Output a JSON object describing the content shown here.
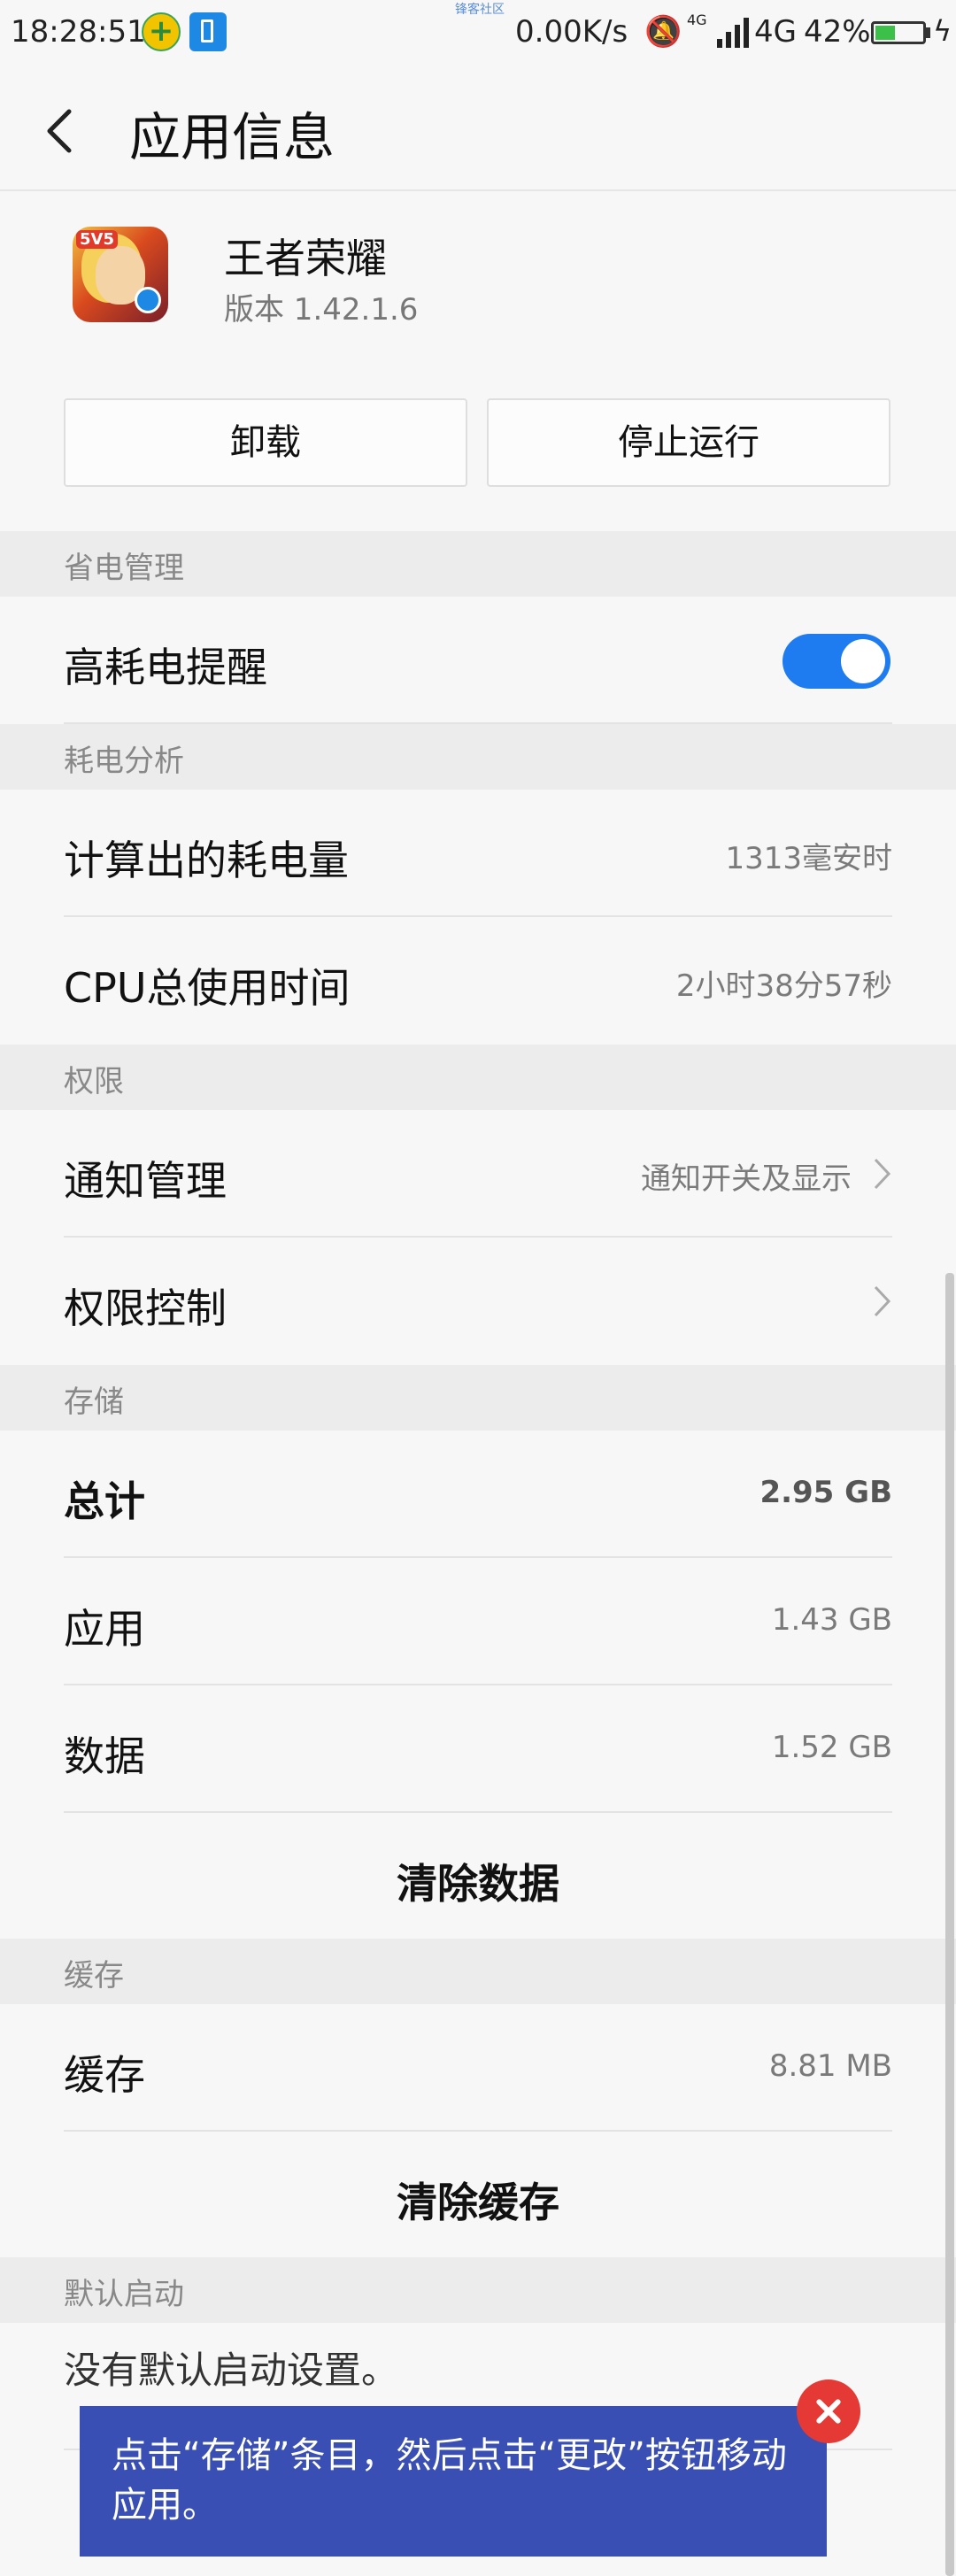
{
  "status_bar": {
    "time": "18:28:51",
    "watermark": "锋客社区",
    "net_speed": "0.00K/s",
    "net_small": "4G",
    "network": "4G",
    "battery_pct": "42%",
    "battery_level": 0.42
  },
  "header": {
    "title": "应用信息"
  },
  "app": {
    "name": "王者荣耀",
    "version": "版本 1.42.1.6",
    "icon_badge": "5V5"
  },
  "buttons": {
    "uninstall": "卸载",
    "stop": "停止运行"
  },
  "power_management": {
    "section": "省电管理",
    "high_drain_label": "高耗电提醒",
    "high_drain_enabled": true
  },
  "power_analysis": {
    "section": "耗电分析",
    "computed_label": "计算出的耗电量",
    "computed_value": "1313毫安时",
    "cpu_label": "CPU总使用时间",
    "cpu_value": "2小时38分57秒"
  },
  "permissions": {
    "section": "权限",
    "notify_label": "通知管理",
    "notify_value": "通知开关及显示",
    "control_label": "权限控制"
  },
  "storage": {
    "section": "存储",
    "total_label": "总计",
    "total_value": "2.95 GB",
    "app_label": "应用",
    "app_value": "1.43 GB",
    "data_label": "数据",
    "data_value": "1.52 GB",
    "clear_data": "清除数据"
  },
  "cache": {
    "section": "缓存",
    "cache_label": "缓存",
    "cache_value": "8.81 MB",
    "clear_cache": "清除缓存"
  },
  "default_launch": {
    "section": "默认启动",
    "text": "没有默认启动设置。"
  },
  "tip": {
    "text": "点击“存储”条目，然后点击“更改”按钮移动应用。"
  },
  "colors": {
    "toggle_on": "#1e7cf0",
    "tip_bg": "#3a4fb4",
    "close_red": "#e53935"
  }
}
